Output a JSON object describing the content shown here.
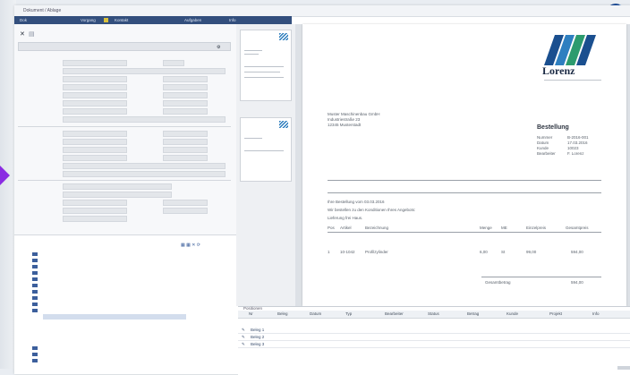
{
  "window": {
    "title": "Dokument / Ablage"
  },
  "tabs": [
    "Dok",
    "Vorgang",
    "Kontakt",
    "Aufgaben",
    "Info"
  ],
  "doc": {
    "brand": "Lorenz",
    "recipient": [
      "Muster Maschinenbau GmbH",
      "Industriestraße 23",
      "12345 Musterstadt"
    ],
    "heading": "Bestellung",
    "meta": [
      "Nummer",
      "Datum",
      "Kunde",
      "Bearbeiter"
    ],
    "meta_vals": [
      "B-2016-001",
      "17.03.2016",
      "10023",
      "F. Lorenz"
    ],
    "body": [
      "Ihre Bestellung vom 03.03.2016",
      "Wir bestellen zu den Konditionen Ihres Angebots:",
      "Lieferung frei Haus."
    ],
    "table_head": [
      "Pos",
      "Artikel",
      "Bezeichnung",
      "Menge",
      "ME",
      "Einzelpreis",
      "Gesamtpreis"
    ],
    "row_vals": [
      "1",
      "10-1042",
      "Profilzylinder",
      "6,00",
      "St",
      "99,00",
      "594,00"
    ],
    "total_label": "Gesamtbetrag",
    "total_val": "594,00"
  },
  "grid": {
    "label": "Positionen",
    "cols": [
      "Nr",
      "Beleg",
      "Datum",
      "Typ",
      "Bearbeiter",
      "Status",
      "Betrag",
      "Kunde",
      "Projekt",
      "Info"
    ],
    "rows": [
      "Beleg 1",
      "Beleg 2",
      "Beleg 3"
    ]
  }
}
